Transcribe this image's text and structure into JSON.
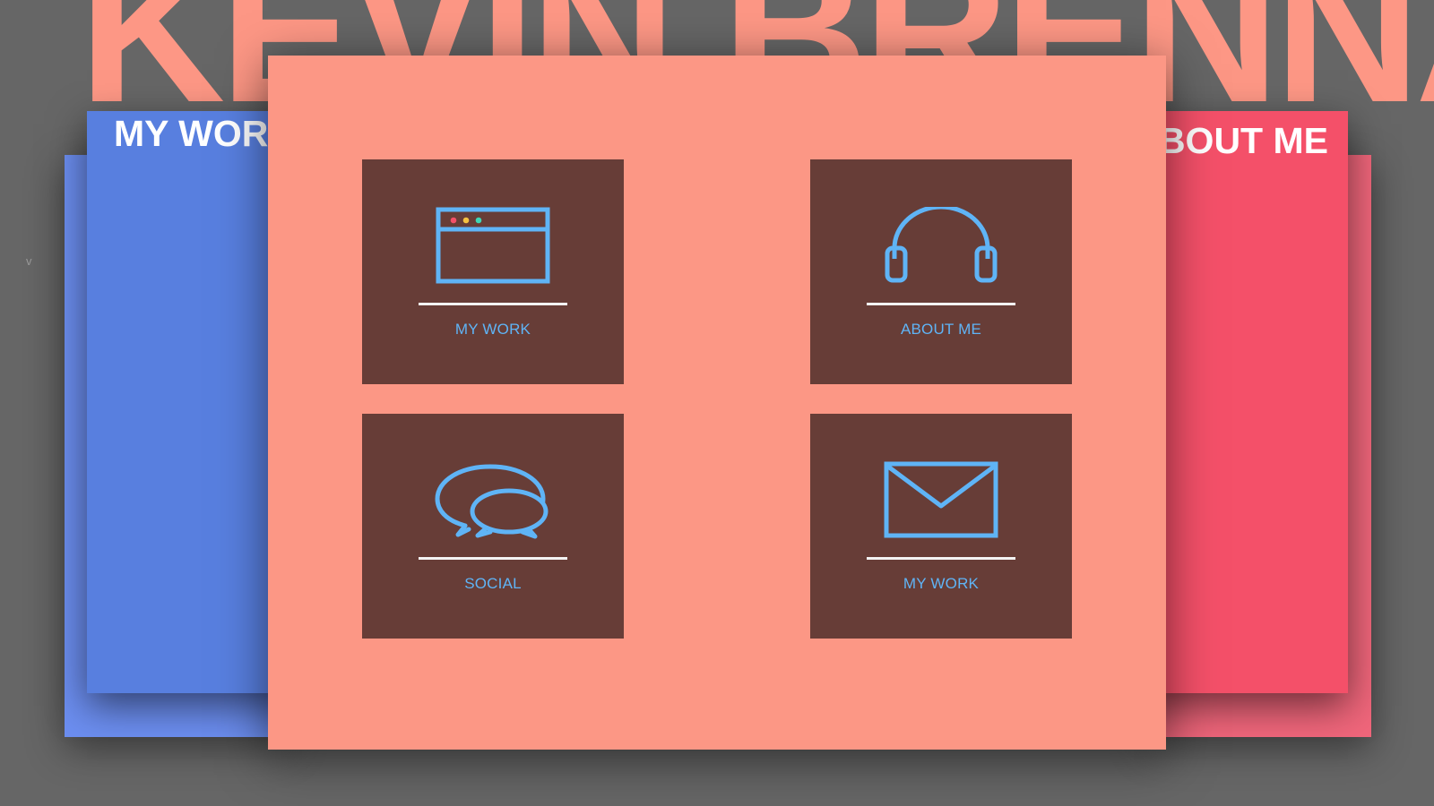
{
  "site": {
    "name": "KEVIN BRENNAN"
  },
  "scroll_hint": "v",
  "panels": {
    "left_title": "MY WORK",
    "right_title": "ABOUT ME"
  },
  "tiles": [
    {
      "label": "MY WORK",
      "icon": "browser-window-icon"
    },
    {
      "label": "ABOUT ME",
      "icon": "headphones-icon"
    },
    {
      "label": "SOCIAL",
      "icon": "chat-bubbles-icon"
    },
    {
      "label": "MY WORK",
      "icon": "envelope-icon"
    }
  ],
  "colors": {
    "background": "#666666",
    "accent_salmon": "#fc9785",
    "tile_brown": "#673d37",
    "icon_blue": "#5fb4f6",
    "panel_blue": "#587fdf",
    "panel_red": "#f45069",
    "dot_red": "#f45069",
    "dot_yellow": "#f5c242",
    "dot_green": "#3ed6b5"
  }
}
